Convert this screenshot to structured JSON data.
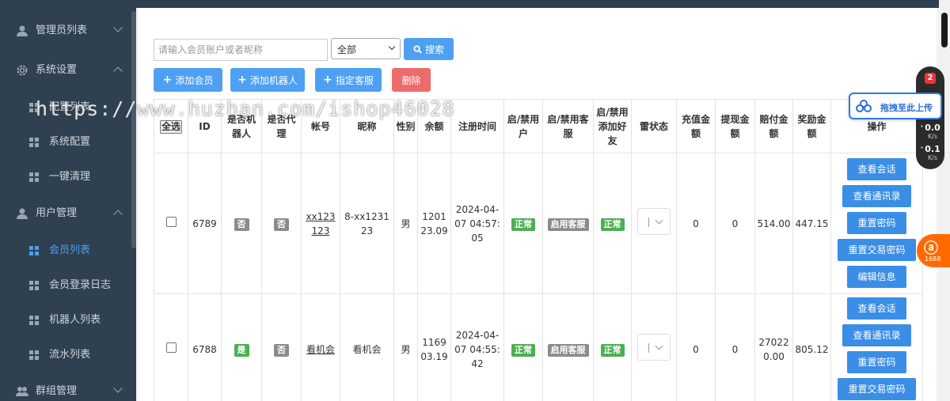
{
  "sidebar": {
    "items": [
      {
        "label": "管理员列表",
        "icon": "user-icon",
        "expanded": false
      },
      {
        "label": "系统设置",
        "icon": "gear-icon",
        "expanded": true
      },
      {
        "label": "配置列表",
        "icon": "grid-icon"
      },
      {
        "label": "系统配置",
        "icon": "grid-icon"
      },
      {
        "label": "一键清理",
        "icon": "grid-icon"
      },
      {
        "label": "用户管理",
        "icon": "user-icon",
        "expanded": true
      },
      {
        "label": "会员列表",
        "icon": "grid-icon",
        "active": true
      },
      {
        "label": "会员登录日志",
        "icon": "grid-icon"
      },
      {
        "label": "机器人列表",
        "icon": "grid-icon"
      },
      {
        "label": "流水列表",
        "icon": "grid-icon"
      },
      {
        "label": "群组管理",
        "icon": "users-icon",
        "expanded": false
      }
    ],
    "active_color": "#4a9ef5"
  },
  "toolbar": {
    "search_placeholder": "请输入会员账户或者昵称",
    "filter_value": "全部",
    "search_label": "搜索",
    "add_member_label": "添加会员",
    "add_robot_label": "添加机器人",
    "assign_cs_label": "指定客服",
    "delete_label": "删除"
  },
  "table": {
    "headers": [
      "全选",
      "ID",
      "是否机器人",
      "是否代理",
      "帐号",
      "昵称",
      "性别",
      "余额",
      "注册时间",
      "启/禁用户",
      "启/禁用客服",
      "启/禁用添加好友",
      "雷状态",
      "充值金额",
      "提现金额",
      "赔付金额",
      "奖励金额",
      "操作"
    ],
    "rows": [
      {
        "id": "6789",
        "is_robot": "否",
        "is_agent": "否",
        "account": "xx123123",
        "nickname": "8-xx123123",
        "gender": "男",
        "balance": "120123.09",
        "reg_time": "2024-04-07 04:57:05",
        "user_status": "正常",
        "cs_status": "启用客服",
        "friend_status": "正常",
        "recharge": "0",
        "withdraw": "0",
        "payout": "514.00",
        "reward": "447.15"
      },
      {
        "id": "6788",
        "is_robot": "是",
        "is_agent": "否",
        "account": "看机会",
        "nickname": "看机会",
        "gender": "男",
        "balance": "116903.19",
        "reg_time": "2024-04-07 04:55:42",
        "user_status": "正常",
        "cs_status": "启用客服",
        "friend_status": "正常",
        "recharge": "0",
        "withdraw": "0",
        "payout": "270220.00",
        "reward": "805.12"
      }
    ],
    "actions": [
      "查看会话",
      "查看通讯录",
      "重置密码",
      "重置交易密码",
      "编辑信息"
    ]
  },
  "watermark": "https://www.huzhan.com/ishop46028",
  "widgets": {
    "speed_badge": "2",
    "up_speed": "0.0",
    "down_speed": "0.1",
    "speed_unit": "K/s",
    "upload_label": "拖拽至此上传",
    "ali_label": "1688"
  }
}
